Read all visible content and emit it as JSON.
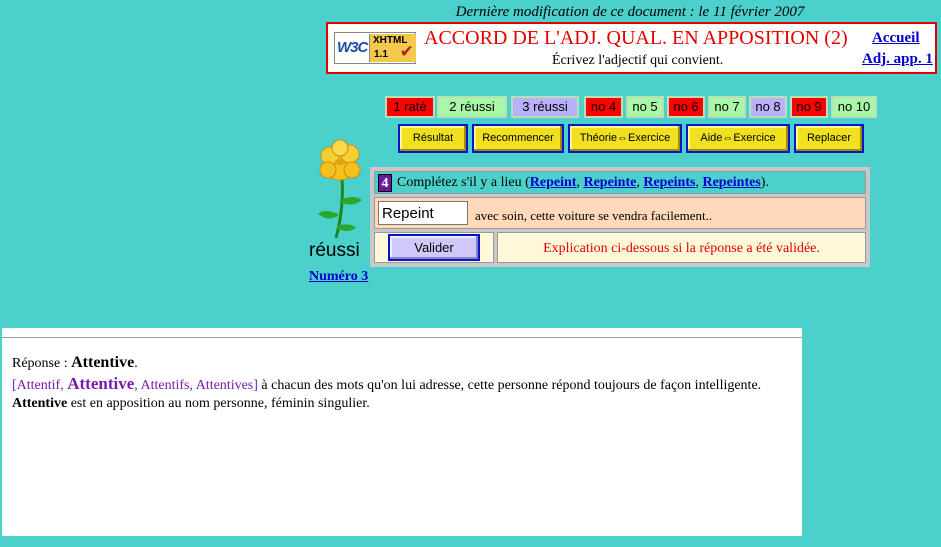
{
  "last_modified": "Dernière modification de ce document : le 11 février 2007",
  "header": {
    "badge_w3c": "W3C",
    "badge_xhtml": "XHTML",
    "badge_version": "1.1",
    "title": "ACCORD DE L'ADJ. QUAL. EN APPOSITION (2)",
    "subtitle": "Écrivez l'adjectif qui convient.",
    "nav_home": "Accueil",
    "nav_adj": "Adj. app. 1"
  },
  "scores": [
    {
      "label": "1 raté",
      "status": "red"
    },
    {
      "label": "2 réussi",
      "status": "green"
    },
    {
      "label": "3 réussi",
      "status": "blue"
    },
    {
      "label": "no 4",
      "status": "red"
    },
    {
      "label": "no 5",
      "status": "green"
    },
    {
      "label": "no 6",
      "status": "red"
    },
    {
      "label": "no 7",
      "status": "green"
    },
    {
      "label": "no 8",
      "status": "blue"
    },
    {
      "label": "no 9",
      "status": "red"
    },
    {
      "label": "no 10",
      "status": "green"
    }
  ],
  "tools": {
    "result": "Résultat",
    "restart": "Recommencer",
    "theory": "Théorie⇔Exercice",
    "help": "Aide⇔Exercice",
    "replace": "Replacer"
  },
  "side": {
    "status": "réussi",
    "number_link": "Numéro 3"
  },
  "exercise": {
    "number": "4",
    "instruction_prefix": "Complétez s'il y a lieu (",
    "options": [
      "Repeint",
      "Repeinte",
      "Repeints",
      "Repeintes"
    ],
    "sep": ", ",
    "instruction_suffix": ").",
    "answer_value": "Repeint",
    "sentence": "avec soin, cette voiture se vendra facilement..",
    "validate_label": "Valider",
    "explanation": "Explication ci-dessous si la réponse a été validée."
  },
  "answer_panel": {
    "line1_prefix": "Réponse : ",
    "line1_answer": "Attentive",
    "line1_end": ".",
    "line2_open": "[Attentif, ",
    "line2_big": "Attentive",
    "line2_rest": ", Attentifs, Attentives]",
    "line2_text": " à chacun des mots qu'on lui adresse, cette personne répond toujours de façon intelligente.",
    "line3_bold": "Attentive",
    "line3_text": " est en apposition au nom personne, féminin singulier."
  },
  "colors": {
    "background": "#4cd0cc",
    "title_red": "#e00000",
    "link_blue": "#0000cc",
    "score_red": "#ff0000",
    "score_green": "#a8f8a8",
    "score_blue": "#b8b0f8",
    "tool_yellow": "#f0e020",
    "input_row": "#ffd9b8",
    "action_row": "#fff9d9"
  }
}
